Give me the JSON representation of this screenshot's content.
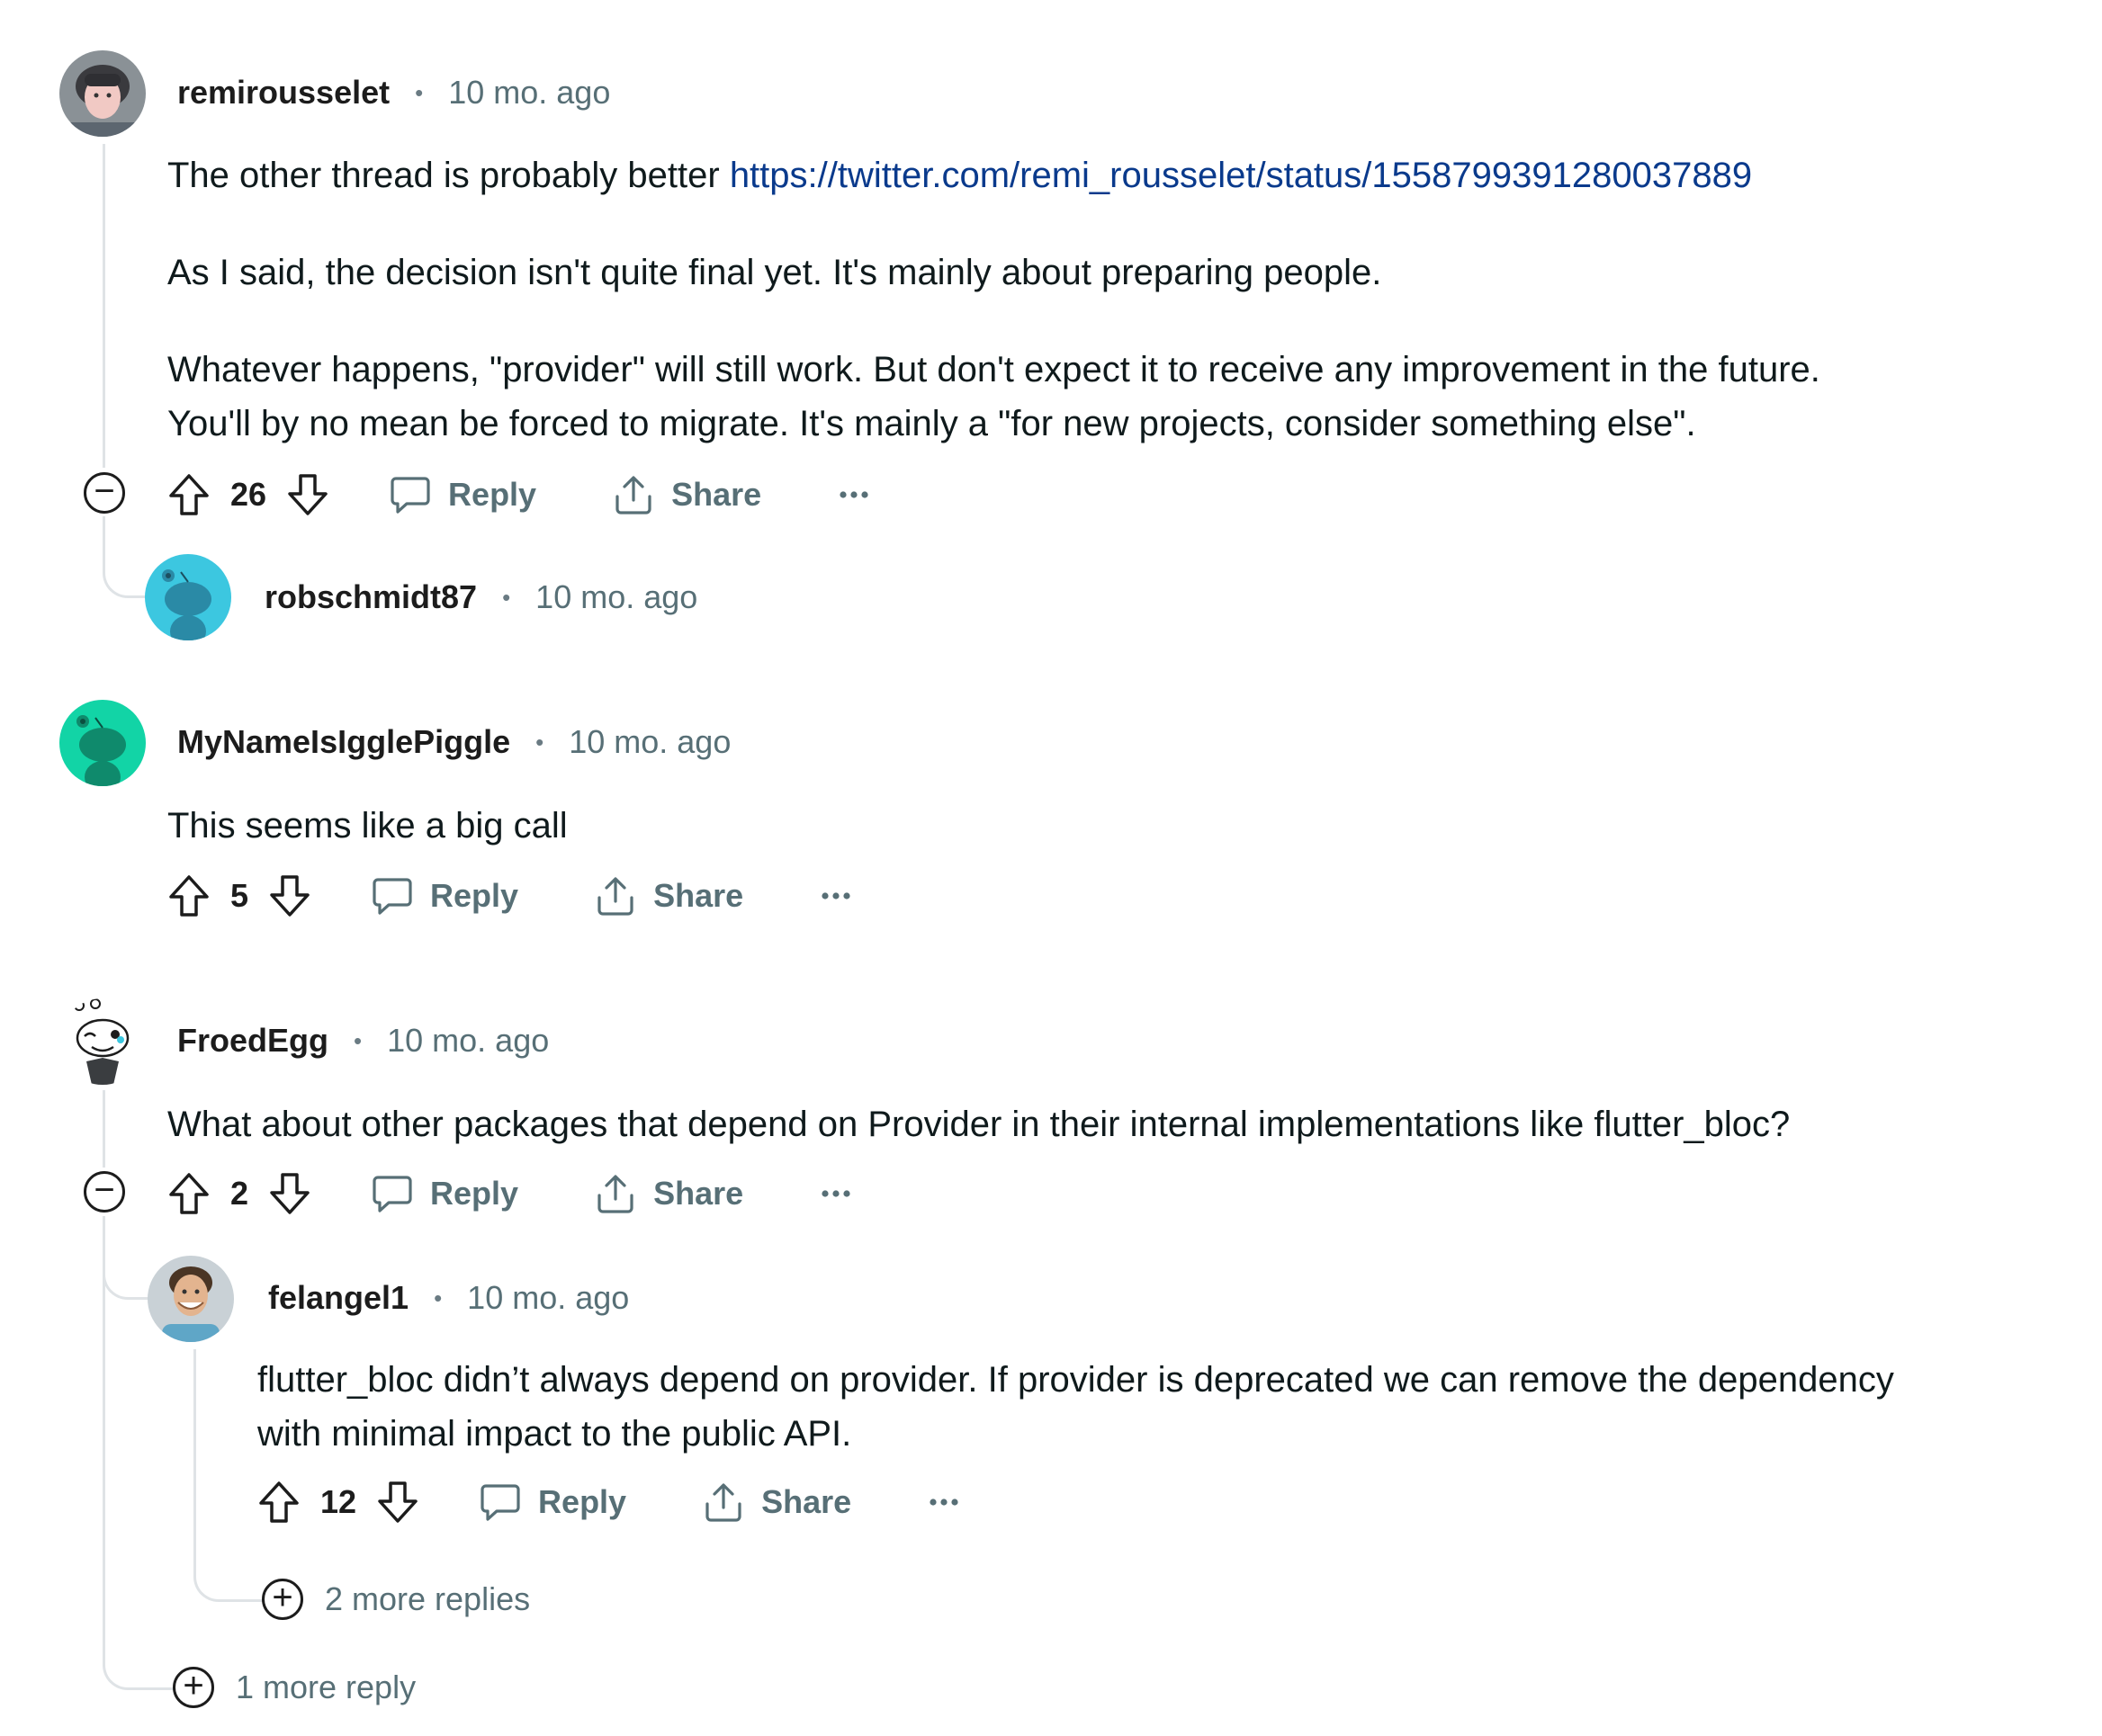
{
  "colors": {
    "author_text": "#1c1c1c",
    "meta_text": "#576f76",
    "link": "#0a3a8c",
    "thread_line": "#dfe3e6",
    "avatar_teal": "#3cc7e0",
    "avatar_green": "#12d4a6"
  },
  "comments": [
    {
      "author": "remirousselet",
      "time": "10 mo. ago",
      "avatar": "photo-avatar-icon",
      "body": {
        "line1_text": "The other thread is probably better ",
        "line1_link": "https://twitter.com/remi_rousselet/status/1558799391280037889",
        "para2": "As I said, the decision isn't quite final yet. It's mainly about preparing people.",
        "para3_line1": "Whatever happens, \"provider\" will still work. But don't expect it to receive any improvement in the future.",
        "para3_line2": "You'll by no mean be forced to migrate. It's mainly a \"for new projects, consider something else\"."
      },
      "score": "26",
      "collapse_icon": "−"
    },
    {
      "author": "robschmidt87",
      "time": "10 mo. ago",
      "avatar": "snoo-avatar-icon"
    },
    {
      "author": "MyNameIsIgglePiggle",
      "time": "10 mo. ago",
      "avatar": "snoo-avatar-icon",
      "body": {
        "text": "This seems like a big call"
      },
      "score": "5"
    },
    {
      "author": "FroedEgg",
      "time": "10 mo. ago",
      "avatar": "snoo-winking-avatar-icon",
      "body": {
        "text": "What about other packages that depend on Provider in their internal implementations like flutter_bloc?"
      },
      "score": "2",
      "collapse_icon": "−",
      "more_replies": "1 more reply"
    },
    {
      "author": "felangel1",
      "time": "10 mo. ago",
      "avatar": "photo-avatar-icon",
      "body": {
        "line1": "flutter_bloc didn’t always depend on provider. If provider is deprecated we can remove the dependency",
        "line2": "with minimal impact to the public API."
      },
      "score": "12",
      "more_replies": "2 more replies"
    }
  ],
  "actions": {
    "reply": "Reply",
    "share": "Share",
    "overflow": "•••",
    "expand_icon": "+",
    "separator": "•"
  }
}
